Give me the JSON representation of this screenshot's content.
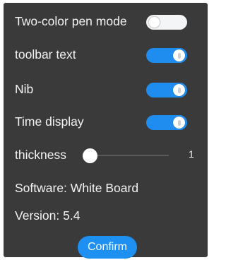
{
  "settings": {
    "two_color_pen_mode": {
      "label": "Two-color pen mode",
      "on": false
    },
    "toolbar_text": {
      "label": "toolbar text",
      "on": true
    },
    "nib": {
      "label": "Nib",
      "on": true
    },
    "time_display": {
      "label": "Time display",
      "on": true
    }
  },
  "thickness": {
    "label": "thickness",
    "value": "1",
    "level": 0
  },
  "info": {
    "software": "Software: White Board",
    "version": "Version: 5.4"
  },
  "confirm_label": "Confirm",
  "colors": {
    "panel": "#3a3a3a",
    "accent": "#1f8df0",
    "toggle_off": "#f4f5f7"
  }
}
